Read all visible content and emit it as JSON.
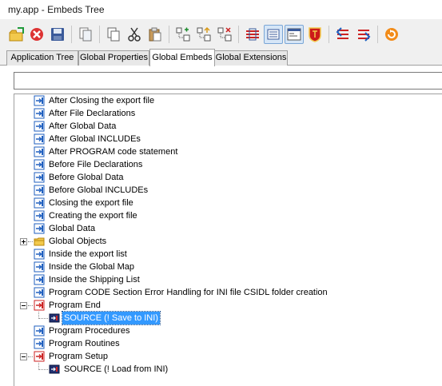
{
  "window": {
    "title": "my.app - Embeds Tree"
  },
  "toolbar": {
    "buttons": [
      {
        "icon": "open-folder-icon"
      },
      {
        "icon": "cancel-icon"
      },
      {
        "icon": "save-icon"
      },
      {
        "icon": "copy-files-icon"
      },
      {
        "icon": "copy-icon"
      },
      {
        "icon": "cut-icon"
      },
      {
        "icon": "paste-icon"
      },
      {
        "icon": "insert-embed-icon"
      },
      {
        "icon": "move-up-embed-icon"
      },
      {
        "icon": "move-down-embed-icon"
      },
      {
        "icon": "show-filled-icon",
        "pressed": false
      },
      {
        "icon": "show-all-icon",
        "pressed": true
      },
      {
        "icon": "source-view-icon",
        "pressed": true
      },
      {
        "icon": "shield-icon"
      },
      {
        "icon": "prev-filled-icon"
      },
      {
        "icon": "next-filled-icon"
      },
      {
        "icon": "refresh-icon"
      }
    ]
  },
  "tabs": [
    {
      "label": "Application Tree",
      "active": false
    },
    {
      "label": "Global Properties",
      "active": false
    },
    {
      "label": "Global Embeds",
      "active": true
    },
    {
      "label": "Global Extensions",
      "active": false
    }
  ],
  "search": {
    "value": "",
    "placeholder": ""
  },
  "tree": {
    "rows": [
      {
        "label": "After Closing the export file",
        "icon": "embed-point-icon",
        "level": 1
      },
      {
        "label": "After File Declarations",
        "icon": "embed-point-icon",
        "level": 1
      },
      {
        "label": "After Global Data",
        "icon": "embed-point-icon",
        "level": 1
      },
      {
        "label": "After Global INCLUDEs",
        "icon": "embed-point-icon",
        "level": 1
      },
      {
        "label": "After PROGRAM code statement",
        "icon": "embed-point-icon",
        "level": 1
      },
      {
        "label": "Before File Declarations",
        "icon": "embed-point-icon",
        "level": 1
      },
      {
        "label": "Before Global Data",
        "icon": "embed-point-icon",
        "level": 1
      },
      {
        "label": "Before Global INCLUDEs",
        "icon": "embed-point-icon",
        "level": 1
      },
      {
        "label": "Closing the export file",
        "icon": "embed-point-icon",
        "level": 1
      },
      {
        "label": "Creating the export file",
        "icon": "embed-point-icon",
        "level": 1
      },
      {
        "label": "Global Data",
        "icon": "embed-point-icon",
        "level": 1
      },
      {
        "label": "Global Objects",
        "icon": "folder-icon",
        "level": 1,
        "expander": "plus"
      },
      {
        "label": "Inside the export list",
        "icon": "embed-point-icon",
        "level": 1
      },
      {
        "label": "Inside the Global Map",
        "icon": "embed-point-icon",
        "level": 1
      },
      {
        "label": "Inside the Shipping List",
        "icon": "embed-point-icon",
        "level": 1
      },
      {
        "label": "Program CODE Section Error Handling for INI file CSIDL folder creation",
        "icon": "embed-point-icon",
        "level": 1
      },
      {
        "label": "Program End",
        "icon": "embed-point-filled-icon",
        "level": 1,
        "expander": "minus"
      },
      {
        "label": "SOURCE (! Save to INI)",
        "icon": "source-embed-icon",
        "level": 2,
        "selected": true
      },
      {
        "label": "Program Procedures",
        "icon": "embed-point-icon",
        "level": 1
      },
      {
        "label": "Program Routines",
        "icon": "embed-point-icon",
        "level": 1
      },
      {
        "label": "Program Setup",
        "icon": "embed-point-filled-icon",
        "level": 1,
        "expander": "minus"
      },
      {
        "label": "SOURCE (! Load from INI)",
        "icon": "source-embed-icon",
        "level": 2
      }
    ]
  },
  "colors": {
    "selection": "#3399ff",
    "embed_icon": "#1f5fbf",
    "filled_embed_icon": "#cc2222",
    "folder": "#f2c94c"
  }
}
